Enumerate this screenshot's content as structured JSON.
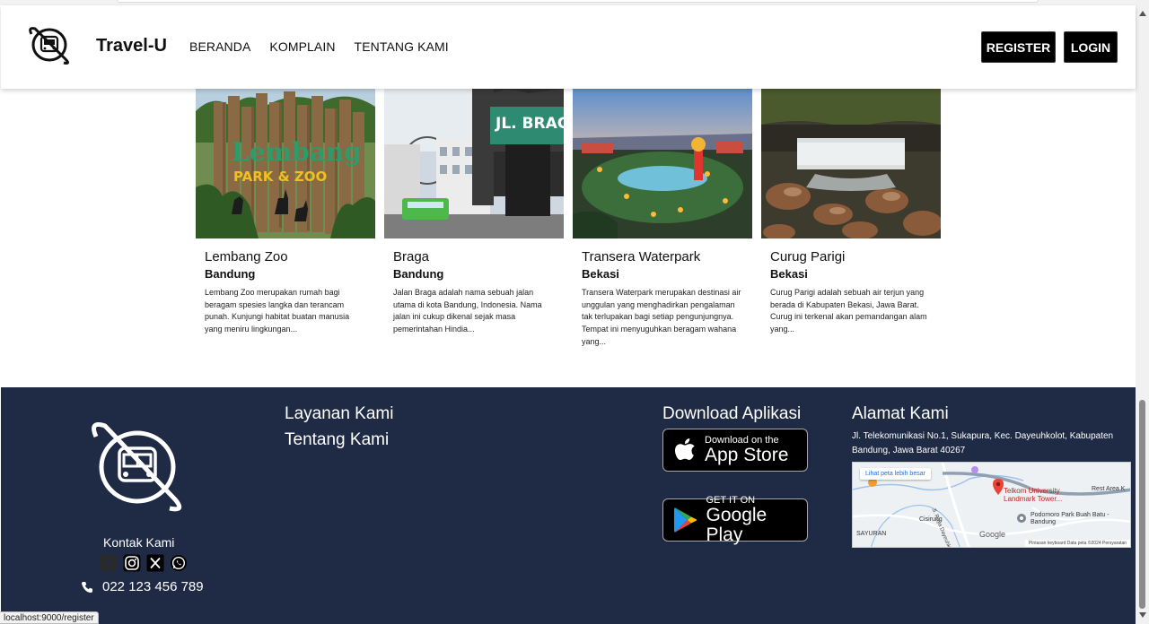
{
  "header": {
    "brand": "Travel-U",
    "nav": [
      "BERANDA",
      "KOMPLAIN",
      "TENTANG KAMI"
    ],
    "register_label": "REGISTER",
    "login_label": "LOGIN"
  },
  "destinations": [
    {
      "title": "Lembang Zoo",
      "city": "Bandung",
      "description": "Lembang Zoo merupakan rumah bagi beragam spesies langka dan terancam punah. Kunjungi habitat buatan manusia yang meniru lingkungan...",
      "image_text": [
        "Lembang",
        "PARK & ZOO"
      ]
    },
    {
      "title": "Braga",
      "city": "Bandung",
      "description": "Jalan Braga adalah nama sebuah jalan utama di kota Bandung, Indonesia. Nama jalan ini cukup dikenal sejak masa pemerintahan Hindia...",
      "image_text": [
        "JL. BRAGA"
      ]
    },
    {
      "title": "Transera Waterpark",
      "city": "Bekasi",
      "description": "Transera Waterpark merupakan destinasi air unggulan yang menghadirkan pengalaman tak terlupakan bagi setiap pengunjungnya. Tempat ini menyuguhkan beragam wahana yang...",
      "image_text": []
    },
    {
      "title": "Curug Parigi",
      "city": "Bekasi",
      "description": "Curug Parigi adalah sebuah air terjun yang berada di Kabupaten Bekasi, Jawa Barat. Curug ini terkenal akan pemandangan alam yang...",
      "image_text": []
    }
  ],
  "footer": {
    "contact_label": "Kontak Kami",
    "phone": "022 123 456 789",
    "services": [
      "Layanan Kami",
      "Tentang Kami"
    ],
    "download_title": "Download Aplikasi",
    "appstore_small": "Download on the",
    "appstore_big": "App Store",
    "googleplay_small": "GET IT ON",
    "googleplay_big": "Google Play",
    "address_title": "Alamat Kami",
    "address": "Jl. Telekomunikasi No.1, Sukapura, Kec. Dayeuhkolot, Kabupaten Bandung, Jawa Barat 40267",
    "map": {
      "larger_map": "Lihat peta lebih besar",
      "pin_label": "Telkom University Landmark Tower...",
      "park_label": "Podomoro Park Buah Batu - Bandung",
      "area_label": "Rest Area K",
      "district": "SAYURAN",
      "cisirung": "Cisirung",
      "road": "Jl. Raya Dayeuhkolot",
      "google": "Google",
      "terms": "Pintasan keyboard   Data peta ©2024   Persyaratan"
    }
  },
  "status_url": "localhost:9000/register"
}
